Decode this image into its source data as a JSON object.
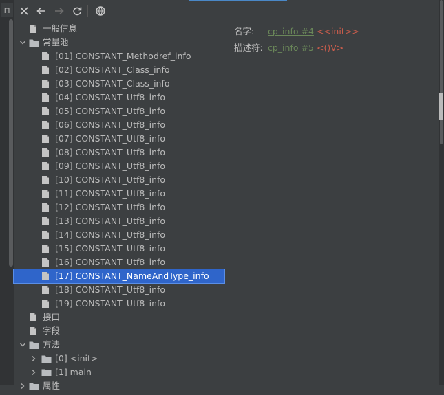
{
  "left_strip": {
    "tab_glyph": "属性"
  },
  "toolbar": {
    "close_tip": "close",
    "back_tip": "back",
    "forward_tip": "forward",
    "refresh_tip": "refresh",
    "web_tip": "web"
  },
  "tree": {
    "general": "一般信息",
    "constant_pool": "常量池",
    "constants": [
      "[01] CONSTANT_Methodref_info",
      "[02] CONSTANT_Class_info",
      "[03] CONSTANT_Class_info",
      "[04] CONSTANT_Utf8_info",
      "[05] CONSTANT_Utf8_info",
      "[06] CONSTANT_Utf8_info",
      "[07] CONSTANT_Utf8_info",
      "[08] CONSTANT_Utf8_info",
      "[09] CONSTANT_Utf8_info",
      "[10] CONSTANT_Utf8_info",
      "[11] CONSTANT_Utf8_info",
      "[12] CONSTANT_Utf8_info",
      "[13] CONSTANT_Utf8_info",
      "[14] CONSTANT_Utf8_info",
      "[15] CONSTANT_Utf8_info",
      "[16] CONSTANT_Utf8_info",
      "[17] CONSTANT_NameAndType_info",
      "[18] CONSTANT_Utf8_info",
      "[19] CONSTANT_Utf8_info"
    ],
    "selected_constant": "[17] CONSTANT_NameAndType_info",
    "interfaces": "接口",
    "fields": "字段",
    "methods": "方法",
    "method_items": [
      "[0] <init>",
      "[1] main"
    ],
    "attributes": "属性"
  },
  "details": {
    "name_label": "名字:",
    "name_link": "cp_info #4",
    "name_value": "<<init>>",
    "descriptor_label": "描述符:",
    "descriptor_link": "cp_info #5",
    "descriptor_value": "<()V>"
  },
  "colors": {
    "background": "#3c3f41",
    "selection": "#2f65ca",
    "link": "#6a8759",
    "value": "#cc5d4c",
    "text": "#bbbbbb"
  }
}
